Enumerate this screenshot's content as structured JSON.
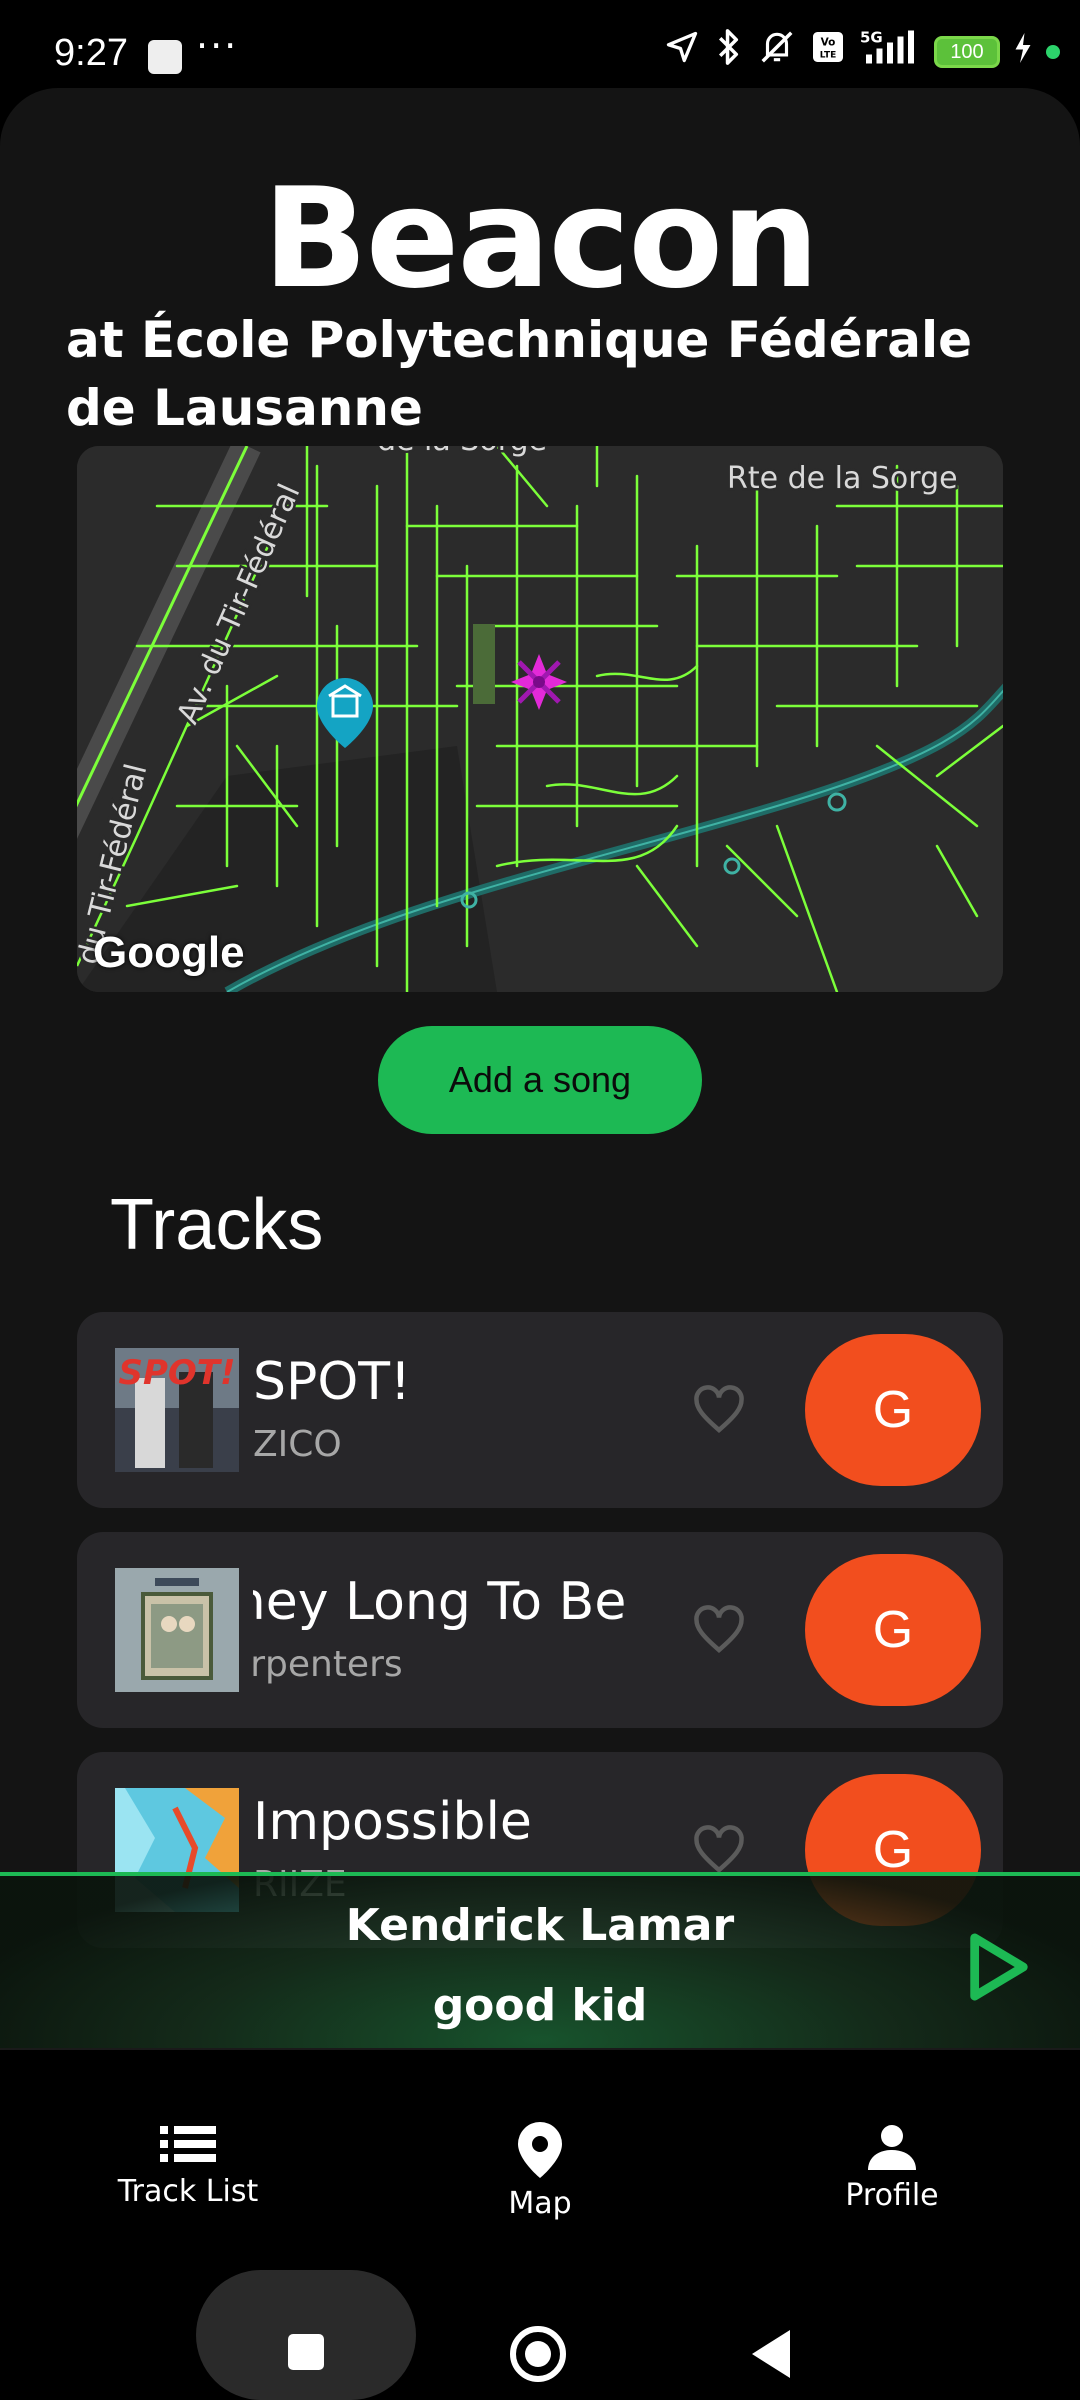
{
  "status_bar": {
    "time": "9:27",
    "dots": "···",
    "network": "5G",
    "volte": "Vo LTE",
    "battery": "100"
  },
  "app": {
    "title": "Beacon",
    "subtitle": "at École Polytechnique Fédérale de Lausanne"
  },
  "map": {
    "street_labels": [
      "Rte de la Sorge",
      "Av. du Tir-Fédéral",
      "du Tir-Fédéral",
      "de la Sorge"
    ],
    "attribution": "Google",
    "marker_icon": "map-pin-museum-icon",
    "beacon_icon": "beacon-star-icon",
    "road_color": "#7cff3a",
    "beacon_color": "#e32ad8"
  },
  "actions": {
    "add_song_label": "Add a song"
  },
  "tracks_section": {
    "title": "Tracks",
    "items": [
      {
        "title": "SPOT!",
        "artist": "ZICO",
        "badge": "G",
        "liked": false
      },
      {
        "title": "They Long To Be",
        "artist": "Carpenters",
        "badge": "G",
        "liked": false
      },
      {
        "title": "Impossible",
        "artist": "RIIZE",
        "badge": "G",
        "liked": false
      }
    ]
  },
  "now_playing": {
    "artist": "Kendrick Lamar",
    "title": "good kid",
    "play_icon": "play-icon",
    "accent": "#1db954"
  },
  "bottom_nav": {
    "items": [
      {
        "label": "Track List",
        "icon": "list-icon"
      },
      {
        "label": "Map",
        "icon": "map-pin-icon"
      },
      {
        "label": "Profile",
        "icon": "person-icon"
      }
    ]
  },
  "colors": {
    "background": "#141414",
    "card": "#272629",
    "badge": "#f24e1e",
    "accent_green": "#1db954"
  }
}
